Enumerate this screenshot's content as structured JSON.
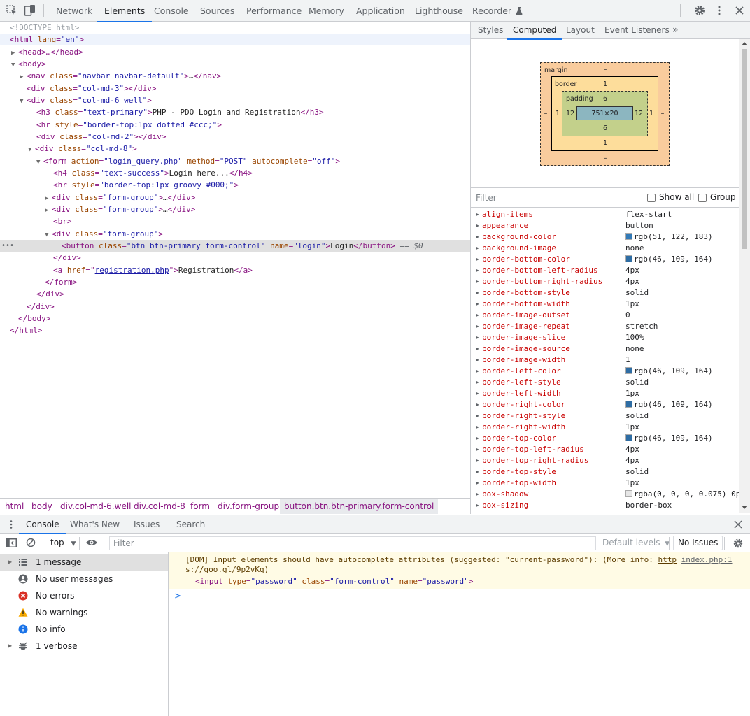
{
  "top_tabs": [
    "Network",
    "Elements",
    "Console",
    "Sources",
    "Performance",
    "Memory",
    "Application",
    "Lighthouse",
    "Recorder"
  ],
  "active_top_tab": "Elements",
  "tree": {
    "doctype": "<!DOCTYPE html>",
    "html_open_tag": "html",
    "lang_attr": "lang",
    "lang_val": "\"en\"",
    "head": "<head>…</head>",
    "body_open": "<body>",
    "nav_tag": "nav",
    "nav_class": "\"navbar navbar-default\"",
    "div": "div",
    "class_attr": "class",
    "col3": "\"col-md-3\"",
    "col6": "\"col-md-6 well\"",
    "h3": "h3",
    "h3_class": "\"text-primary\"",
    "h3_text": "PHP - PDO Login and Registration",
    "hr": "hr",
    "style_attr": "style",
    "hr1_style": "\"border-top:1px dotted #ccc;\"",
    "col2": "\"col-md-2\"",
    "col8": "\"col-md-8\"",
    "form": "form",
    "action_attr": "action",
    "action_val": "\"login_query.php\"",
    "method_attr": "method",
    "method_val": "\"POST\"",
    "autocomplete_attr": "autocomplete",
    "autocomplete_val": "\"off\"",
    "h4": "h4",
    "h4_class": "\"text-success\"",
    "h4_text": "Login here...",
    "hr2_style": "\"border-top:1px groovy #000;\"",
    "form_group": "\"form-group\"",
    "br": "<br>",
    "button": "button",
    "button_class": "\"btn btn-primary form-control\"",
    "name_attr": "name",
    "button_name": "\"login\"",
    "button_text": "Login",
    "selected_marker": "== $0",
    "a": "a",
    "href_attr": "href",
    "href_val": "registration.php",
    "a_text": "Registration",
    "close_div": "</div>",
    "close_form": "</form>",
    "close_body": "</body>",
    "close_html": "</html>",
    "collapsed": "…",
    "ellipsis_menu": "•••"
  },
  "breadcrumbs": [
    "html",
    "body",
    "div.col-md-6.well",
    "div.col-md-8",
    "form",
    "div.form-group",
    "button.btn.btn-primary.form-control"
  ],
  "side_tabs": [
    "Styles",
    "Computed",
    "Layout",
    "Event Listeners",
    "»"
  ],
  "active_side_tab": "Computed",
  "box_model": {
    "margin_label": "margin",
    "margin_top": "–",
    "margin_bottom": "–",
    "margin_left": "–",
    "margin_right": "–",
    "border_label": "border",
    "border_top": "1",
    "border_bottom": "1",
    "border_left": "1",
    "border_right": "1",
    "padding_label": "padding",
    "padding_top": "6",
    "padding_bottom": "6",
    "padding_left": "12",
    "padding_right": "12",
    "content": "751×20",
    "colors": {
      "margin": "#f9cc9d",
      "border": "#fddd9b",
      "padding": "#c3d08b",
      "content": "#8cb6c0"
    }
  },
  "computed_filter": {
    "placeholder": "Filter",
    "show_all": "Show all",
    "group": "Group"
  },
  "computed_props": [
    {
      "name": "align-items",
      "value": "flex-start"
    },
    {
      "name": "appearance",
      "value": "button"
    },
    {
      "name": "background-color",
      "value": "rgb(51, 122, 183)",
      "swatch": "#337ab7"
    },
    {
      "name": "background-image",
      "value": "none"
    },
    {
      "name": "border-bottom-color",
      "value": "rgb(46, 109, 164)",
      "swatch": "#2e6da4"
    },
    {
      "name": "border-bottom-left-radius",
      "value": "4px"
    },
    {
      "name": "border-bottom-right-radius",
      "value": "4px"
    },
    {
      "name": "border-bottom-style",
      "value": "solid"
    },
    {
      "name": "border-bottom-width",
      "value": "1px"
    },
    {
      "name": "border-image-outset",
      "value": "0"
    },
    {
      "name": "border-image-repeat",
      "value": "stretch"
    },
    {
      "name": "border-image-slice",
      "value": "100%"
    },
    {
      "name": "border-image-source",
      "value": "none"
    },
    {
      "name": "border-image-width",
      "value": "1"
    },
    {
      "name": "border-left-color",
      "value": "rgb(46, 109, 164)",
      "swatch": "#2e6da4"
    },
    {
      "name": "border-left-style",
      "value": "solid"
    },
    {
      "name": "border-left-width",
      "value": "1px"
    },
    {
      "name": "border-right-color",
      "value": "rgb(46, 109, 164)",
      "swatch": "#2e6da4"
    },
    {
      "name": "border-right-style",
      "value": "solid"
    },
    {
      "name": "border-right-width",
      "value": "1px"
    },
    {
      "name": "border-top-color",
      "value": "rgb(46, 109, 164)",
      "swatch": "#2e6da4"
    },
    {
      "name": "border-top-left-radius",
      "value": "4px"
    },
    {
      "name": "border-top-right-radius",
      "value": "4px"
    },
    {
      "name": "border-top-style",
      "value": "solid"
    },
    {
      "name": "border-top-width",
      "value": "1px"
    },
    {
      "name": "box-shadow",
      "value": "rgba(0, 0, 0, 0.075) 0p",
      "swatch": "#e6e6e6"
    },
    {
      "name": "box-sizing",
      "value": "border-box"
    }
  ],
  "drawer_tabs": [
    "Console",
    "What's New",
    "Issues",
    "Search"
  ],
  "active_drawer_tab": "Console",
  "console_toolbar": {
    "context": "top",
    "filter_placeholder": "Filter",
    "levels": "Default levels",
    "issues": "No Issues"
  },
  "console_sidebar": [
    {
      "label": "1 message",
      "icon": "list-icon",
      "expandable": true,
      "selected": true
    },
    {
      "label": "No user messages",
      "icon": "user-icon"
    },
    {
      "label": "No errors",
      "icon": "error-icon"
    },
    {
      "label": "No warnings",
      "icon": "warning-icon"
    },
    {
      "label": "No info",
      "icon": "info-icon"
    },
    {
      "label": "1 verbose",
      "icon": "bug-icon",
      "expandable": true
    }
  ],
  "console_warning": {
    "text": "[DOM] Input elements should have autocomplete attributes (suggested: \"current-password\"): (More info: ",
    "link1": "http",
    "link2": "index.php:1",
    "link_rest": "s://goo.gl/9p2vKq",
    "close": ")",
    "snippet_tag": "input",
    "snippet_type_attr": "type",
    "snippet_type_val": "\"password\"",
    "snippet_class_attr": "class",
    "snippet_class_val": "\"form-control\"",
    "snippet_name_attr": "name",
    "snippet_name_val": "\"password\""
  },
  "console_prompt": ">"
}
